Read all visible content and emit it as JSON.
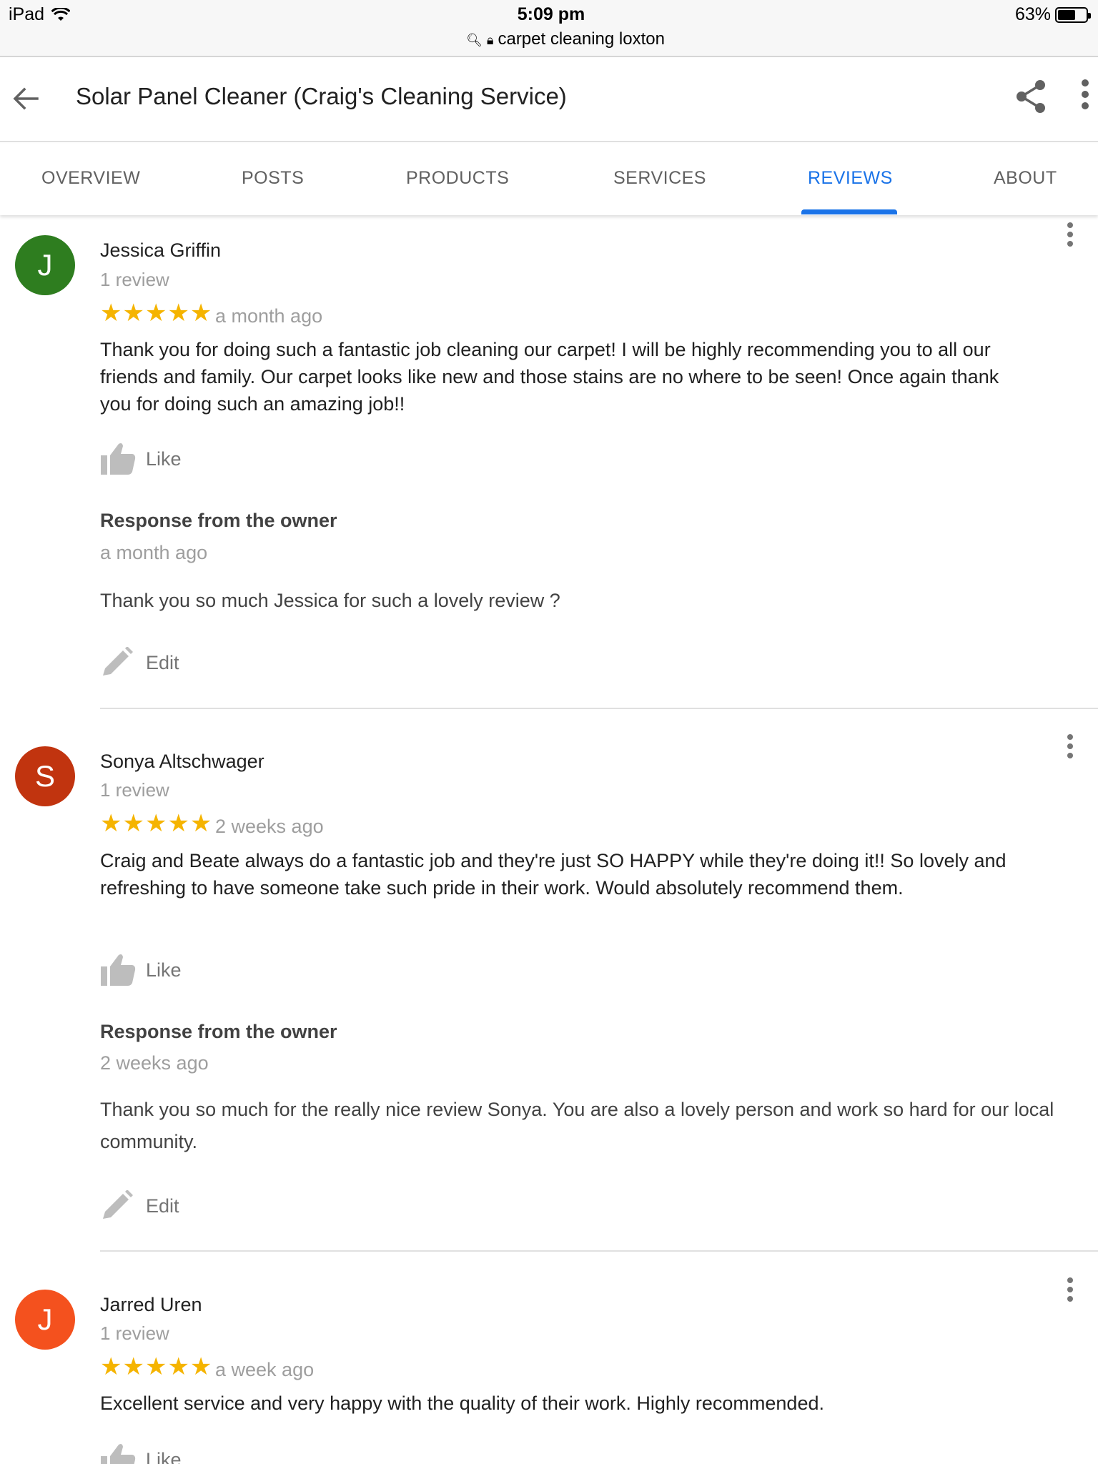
{
  "status_bar": {
    "device": "iPad",
    "time": "5:09 pm",
    "url": "carpet cleaning loxton",
    "battery": "63%",
    "battery_level": 0.63
  },
  "app_bar": {
    "title": "Solar Panel Cleaner (Craig's Cleaning Service)",
    "icons": [
      "back-arrow-icon",
      "share-icon",
      "more-vert-icon"
    ]
  },
  "tabs": [
    {
      "label": "OVERVIEW",
      "active": false
    },
    {
      "label": "POSTS",
      "active": false
    },
    {
      "label": "PRODUCTS",
      "active": false
    },
    {
      "label": "SERVICES",
      "active": false
    },
    {
      "label": "REVIEWS",
      "active": true
    },
    {
      "label": "ABOUT",
      "active": false
    }
  ],
  "colors": {
    "accent": "#1a73e8",
    "stars": "#f5b400"
  },
  "reviews": [
    {
      "initial": "J",
      "avatar_color": "#2e7d1f",
      "name": "Jessica Griffin",
      "review_count": "1 review",
      "stars": "★★★★★",
      "rating": 5,
      "time": "a month ago",
      "text": "Thank you for doing such a fantastic job cleaning our carpet! I will be highly recommending you to all our friends and family. Our carpet looks like new and those stains are no where to be seen! Once again thank you for doing such an amazing job!!",
      "like_label": "Like",
      "response_heading": "Response from the owner",
      "response_time": "a month ago",
      "response_text": "Thank you so much Jessica for such a lovely review ?",
      "edit_label": "Edit"
    },
    {
      "initial": "S",
      "avatar_color": "#c1340f",
      "name": "Sonya Altschwager",
      "review_count": "1 review",
      "stars": "★★★★★",
      "rating": 5,
      "time": "2 weeks ago",
      "text": "Craig and Beate always do a fantastic job and they're just SO HAPPY while they're doing it!!  So lovely and refreshing to have someone take such pride in their work. Would absolutely recommend them.",
      "like_label": "Like",
      "response_heading": "Response from the owner",
      "response_time": "2 weeks ago",
      "response_text": "Thank you so much for the really nice review Sonya. You are also a lovely person and work so hard for our local community.",
      "edit_label": "Edit"
    },
    {
      "initial": "J",
      "avatar_color": "#f4511e",
      "name": "Jarred Uren",
      "review_count": "1 review",
      "stars": "★★★★★",
      "rating": 5,
      "time": "a week ago",
      "text": "Excellent service and very happy with the quality of their work. Highly recommended.",
      "like_label": "Like"
    }
  ]
}
